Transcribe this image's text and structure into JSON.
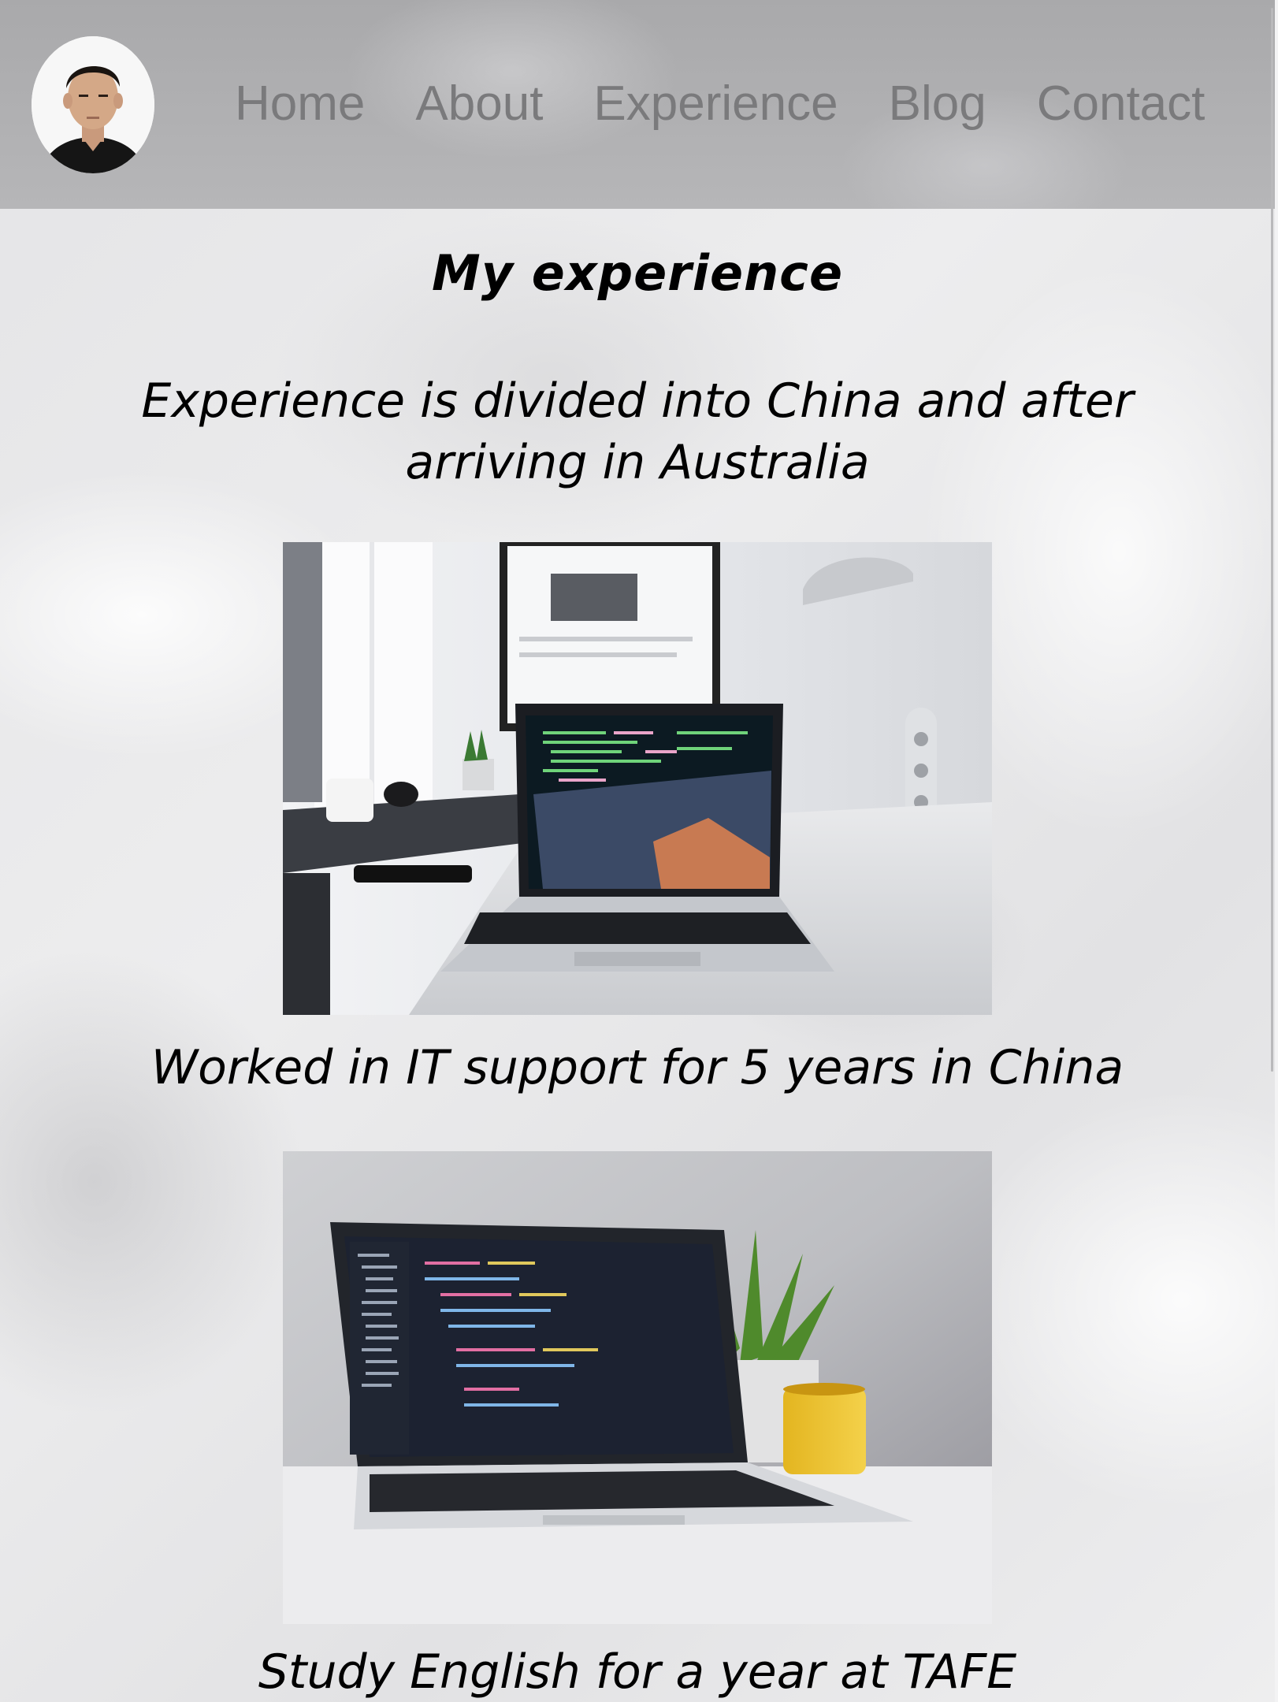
{
  "nav": {
    "items": [
      {
        "label": "Home"
      },
      {
        "label": "About"
      },
      {
        "label": "Experience"
      },
      {
        "label": "Blog"
      },
      {
        "label": "Contact"
      }
    ]
  },
  "main": {
    "title": "My experience",
    "intro": "Experience is divided into China and after arriving in Australia",
    "entries": [
      {
        "caption": "Worked in IT support for 5 years in China"
      },
      {
        "caption": "Study English for a year at TAFE"
      }
    ]
  }
}
